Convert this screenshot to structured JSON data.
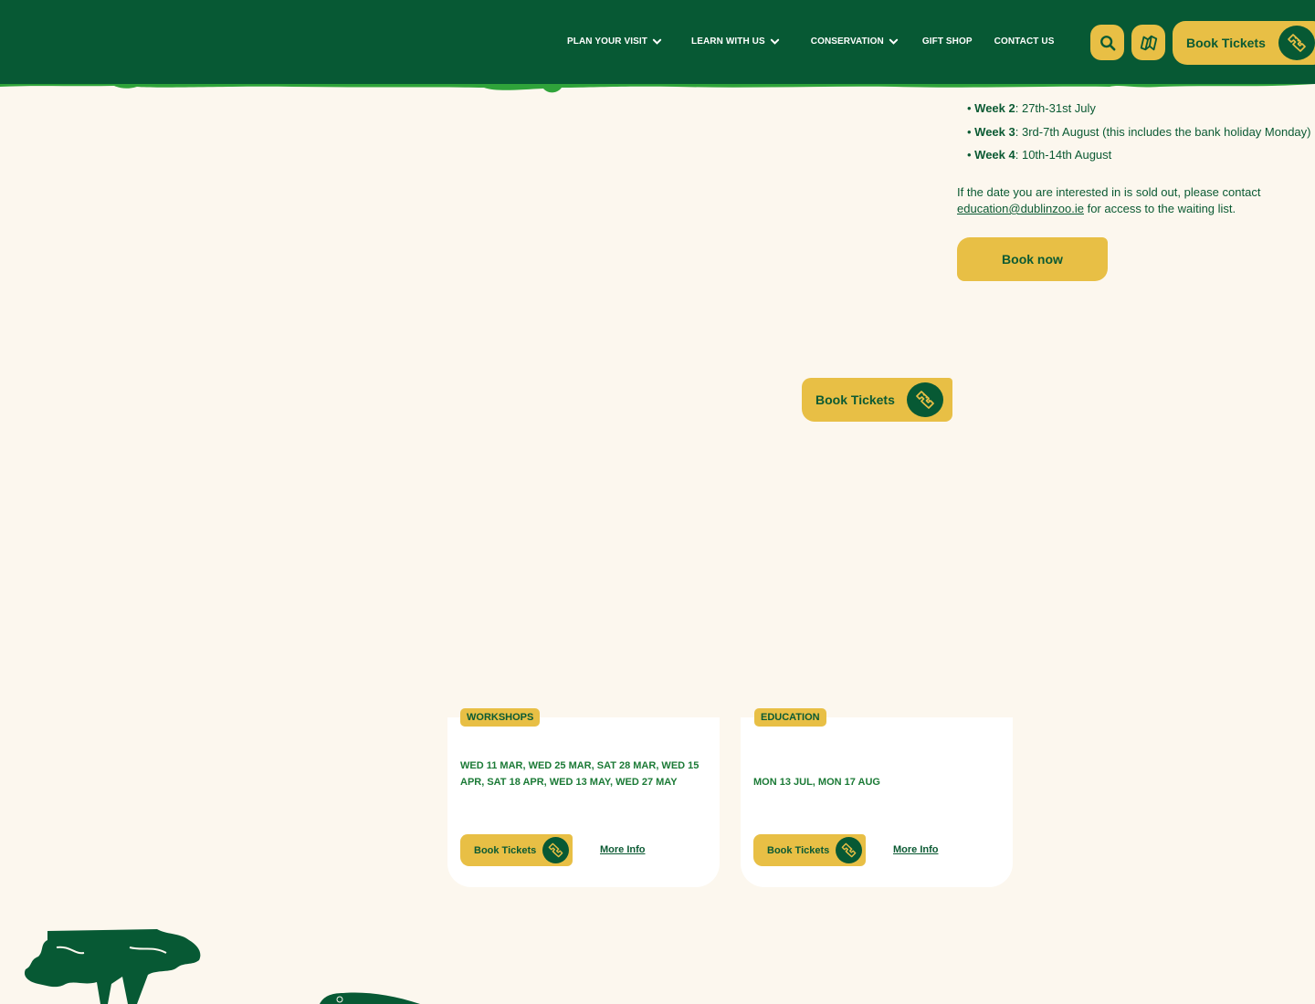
{
  "header": {
    "nav": [
      {
        "label": "PLAN YOUR VISIT",
        "dropdown": true
      },
      {
        "label": "LEARN WITH US",
        "dropdown": true
      },
      {
        "label": "CONSERVATION",
        "dropdown": true
      },
      {
        "label": "GIFT SHOP",
        "dropdown": false
      },
      {
        "label": "CONTACT US",
        "dropdown": false
      }
    ],
    "search_icon": "search-icon",
    "map_icon": "map-icon",
    "book_tickets_label": "Book Tickets",
    "ticket_icon": "ticket-icon"
  },
  "content": {
    "weeks": [
      {
        "name": "Week 2",
        "dates": ": 27th-31st July"
      },
      {
        "name": "Week 3",
        "dates": ": 3rd-7th August (this includes the bank holiday Monday)"
      },
      {
        "name": "Week 4",
        "dates": ": 10th-14th August"
      }
    ],
    "soldout_text_before": "If the date you are interested in is sold out, please contact",
    "soldout_email": "education@dublinzoo.ie",
    "soldout_text_after": " for access to the waiting list.",
    "book_now_label": "Book now",
    "book_tickets_label": "Book Tickets"
  },
  "cards": [
    {
      "tag": "WORKSHOPS",
      "dates": "WED 11 MAR, WED 25 MAR, SAT 28 MAR, WED 15 APR, SAT 18 APR, WED 13 MAY, WED 27 MAY",
      "book_label": "Book Tickets",
      "more_label": "More Info"
    },
    {
      "tag": "EDUCATION",
      "dates": "MON 13 JUL, MON 17 AUG",
      "book_label": "Book Tickets",
      "more_label": "More Info"
    }
  ],
  "colors": {
    "header_green": "#075934",
    "accent_green": "#2fa33a",
    "yellow": "#e8bf45",
    "page_bg": "#fcf7ee"
  }
}
